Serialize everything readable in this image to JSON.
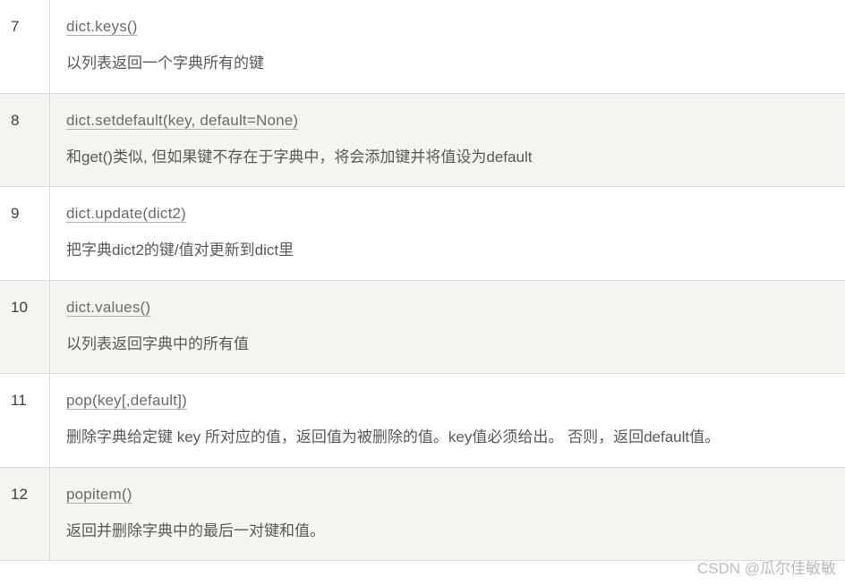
{
  "rows": [
    {
      "number": "7",
      "row_class": "odd",
      "method": "dict.keys()",
      "description": "以列表返回一个字典所有的键"
    },
    {
      "number": "8",
      "row_class": "even",
      "method": "dict.setdefault(key, default=None)",
      "description": "和get()类似, 但如果键不存在于字典中，将会添加键并将值设为default"
    },
    {
      "number": "9",
      "row_class": "odd",
      "method": "dict.update(dict2)",
      "description": "把字典dict2的键/值对更新到dict里"
    },
    {
      "number": "10",
      "row_class": "even",
      "method": "dict.values()",
      "description": "以列表返回字典中的所有值"
    },
    {
      "number": "11",
      "row_class": "odd",
      "method": "pop(key[,default])",
      "description": "删除字典给定键 key 所对应的值，返回值为被删除的值。key值必须给出。 否则，返回default值。"
    },
    {
      "number": "12",
      "row_class": "even",
      "method": "popitem()",
      "description": "返回并删除字典中的最后一对键和值。"
    }
  ],
  "watermark": "CSDN @瓜尔佳敏敏"
}
